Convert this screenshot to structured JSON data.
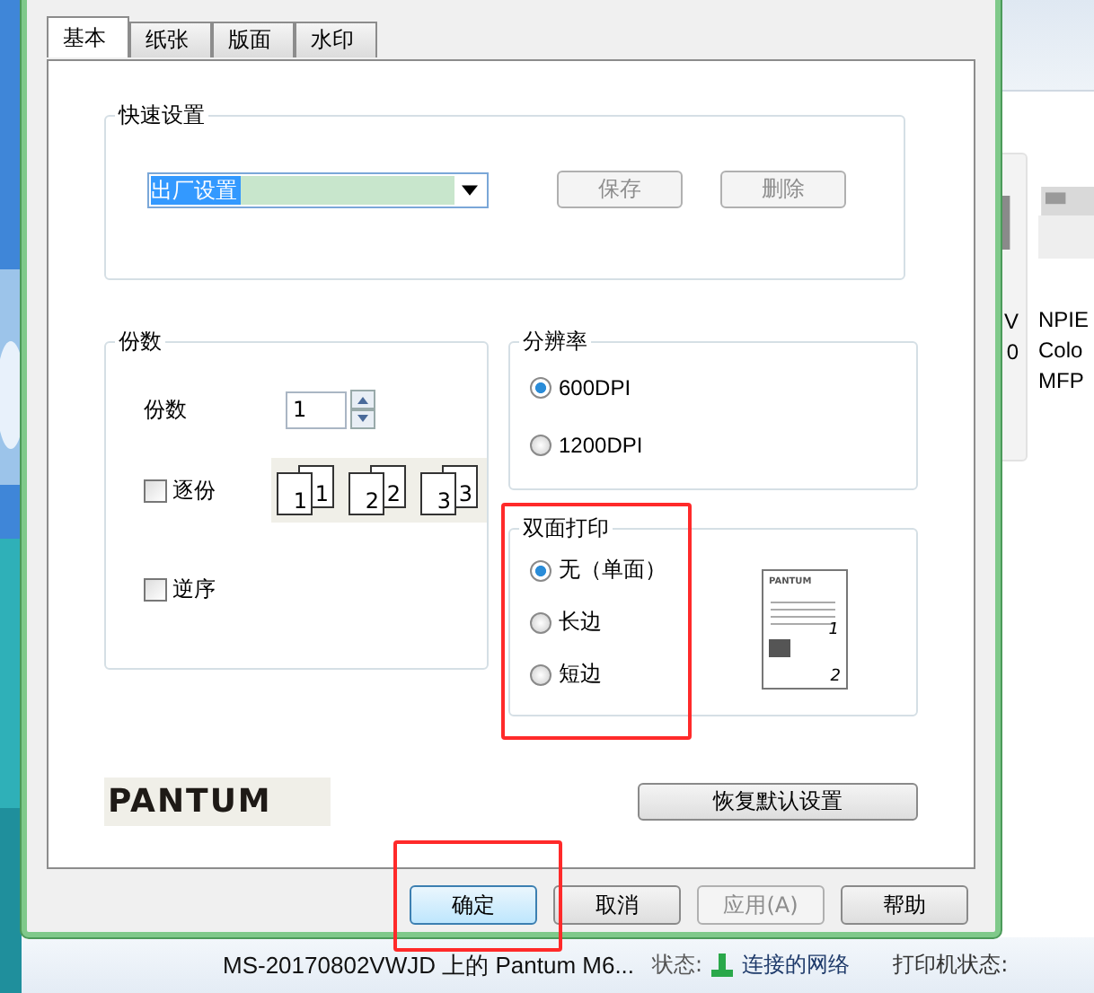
{
  "tabs": [
    {
      "label": "基本",
      "selected": true
    },
    {
      "label": "纸张",
      "selected": false
    },
    {
      "label": "版面",
      "selected": false
    },
    {
      "label": "水印",
      "selected": false
    }
  ],
  "quick_settings": {
    "legend": "快速设置",
    "preset": "出厂设置",
    "buttons": [
      {
        "label": "保存",
        "disabled": true
      },
      {
        "label": "删除",
        "disabled": true
      }
    ]
  },
  "copies": {
    "legend": "份数",
    "label": "份数",
    "value": "1",
    "collate": {
      "label": "逐份",
      "checked": false
    },
    "reverse": {
      "label": "逆序",
      "checked": false
    },
    "collate_pages": [
      {
        "front": "1",
        "back": "1"
      },
      {
        "front": "2",
        "back": "2"
      },
      {
        "front": "3",
        "back": "3"
      }
    ]
  },
  "resolution": {
    "legend": "分辨率",
    "options": [
      {
        "label": "600DPI",
        "selected": true
      },
      {
        "label": "1200DPI",
        "selected": false
      }
    ]
  },
  "duplex": {
    "legend": "双面打印",
    "options": [
      {
        "label": "无（单面）",
        "selected": true
      },
      {
        "label": "长边",
        "selected": false
      },
      {
        "label": "短边",
        "selected": false
      }
    ],
    "preview_logo": "PANTUM",
    "preview_pages": [
      "1",
      "2"
    ]
  },
  "logo": "PANTUM",
  "restore_button": "恢复默认设置",
  "buttons": [
    {
      "label": "确定",
      "disabled": false,
      "selected": true
    },
    {
      "label": "取消",
      "disabled": false,
      "selected": false
    },
    {
      "label": "应用(A)",
      "disabled": true,
      "selected": false
    },
    {
      "label": "帮助",
      "disabled": false,
      "selected": false
    }
  ],
  "explorer": {
    "printers": [
      {
        "lines": [
          "V",
          "0"
        ]
      },
      {
        "lines": [
          "NPIE",
          "Colo",
          "MFP"
        ]
      }
    ],
    "status_bar": {
      "printer_name": "MS-20170802VWJD 上的 Pantum M6...",
      "status_label": "状态:",
      "status_value": "连接的网络",
      "printer_status_label": "打印机状态:"
    }
  }
}
